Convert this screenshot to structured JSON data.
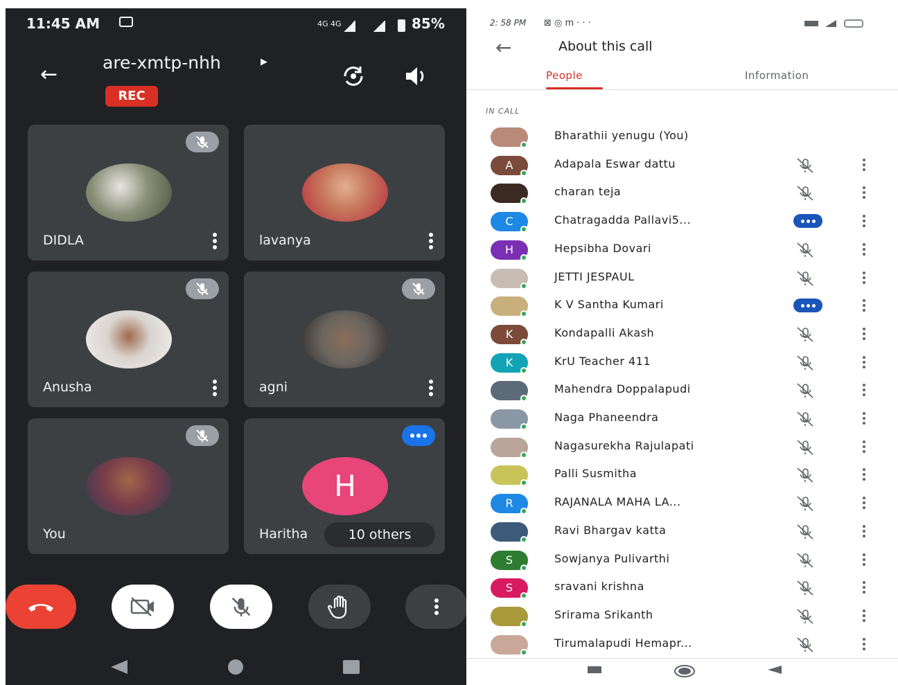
{
  "left": {
    "status": {
      "time": "11:45 AM",
      "network": "4G  4G",
      "battery": "85%"
    },
    "meeting_code": "are-xmtp-nhh",
    "rec_label": "REC",
    "tiles": [
      {
        "name": "DIDLA",
        "state": "muted",
        "avatar_color": "#8a8f78"
      },
      {
        "name": "lavanya",
        "state": "none",
        "avatar_color": "#c77a5e"
      },
      {
        "name": "Anusha",
        "state": "muted",
        "avatar_color": "#d9d4cf"
      },
      {
        "name": "agni",
        "state": "muted",
        "avatar_color": "#6b6660"
      },
      {
        "name": "You",
        "state": "muted",
        "avatar_color": "#7a3d4a"
      },
      {
        "name": "Haritha",
        "state": "speaking",
        "initial": "H",
        "others_label": "10 others"
      }
    ]
  },
  "right": {
    "status": {
      "time": "2: 58 PM",
      "icons": "⊠ ◎ m  · · ·"
    },
    "title": "About this call",
    "tabs": {
      "people": "People",
      "information": "Information"
    },
    "section_label": "IN CALL",
    "participants": [
      {
        "name": "Bharathii yenugu (You)",
        "avatar": "",
        "color": "#b98a7a",
        "state": "none"
      },
      {
        "name": "Adapala Eswar dattu",
        "avatar": "A",
        "color": "#7b4a3a",
        "state": "muted"
      },
      {
        "name": "charan teja",
        "avatar": "",
        "color": "#3a2a22",
        "state": "muted"
      },
      {
        "name": "Chatragadda Pallavi5...",
        "avatar": "C",
        "color": "#1e88e5",
        "state": "speaking"
      },
      {
        "name": "Hepsibha Dovari",
        "avatar": "H",
        "color": "#7b2fb5",
        "state": "muted"
      },
      {
        "name": "JETTI JESPAUL",
        "avatar": "",
        "color": "#c9bcb3",
        "state": "muted"
      },
      {
        "name": "K V Santha Kumari",
        "avatar": "",
        "color": "#c8b07c",
        "state": "speaking"
      },
      {
        "name": "Kondapalli Akash",
        "avatar": "K",
        "color": "#7b4a3a",
        "state": "muted"
      },
      {
        "name": "KrU Teacher 411",
        "avatar": "K",
        "color": "#12a4b5",
        "state": "muted"
      },
      {
        "name": "Mahendra Doppalapudi",
        "avatar": "",
        "color": "#5d6a78",
        "state": "muted"
      },
      {
        "name": "Naga Phaneendra",
        "avatar": "",
        "color": "#8a97a5",
        "state": "muted"
      },
      {
        "name": "Nagasurekha Rajulapati",
        "avatar": "",
        "color": "#b9a59a",
        "state": "muted"
      },
      {
        "name": "Palli Susmitha",
        "avatar": "",
        "color": "#c9c45a",
        "state": "muted"
      },
      {
        "name": "RAJANALA MAHA LA...",
        "avatar": "R",
        "color": "#1e88e5",
        "state": "muted"
      },
      {
        "name": "Ravi Bhargav katta",
        "avatar": "",
        "color": "#3d5a7a",
        "state": "muted"
      },
      {
        "name": "Sowjanya Pulivarthi",
        "avatar": "S",
        "color": "#2e7d32",
        "state": "muted"
      },
      {
        "name": "sravani krishna",
        "avatar": "S",
        "color": "#d81b60",
        "state": "muted"
      },
      {
        "name": "Srirama Srikanth",
        "avatar": "",
        "color": "#a89a3a",
        "state": "muted"
      },
      {
        "name": "Tirumalapudi Hemapr...",
        "avatar": "",
        "color": "#c9a89a",
        "state": "muted"
      }
    ]
  }
}
